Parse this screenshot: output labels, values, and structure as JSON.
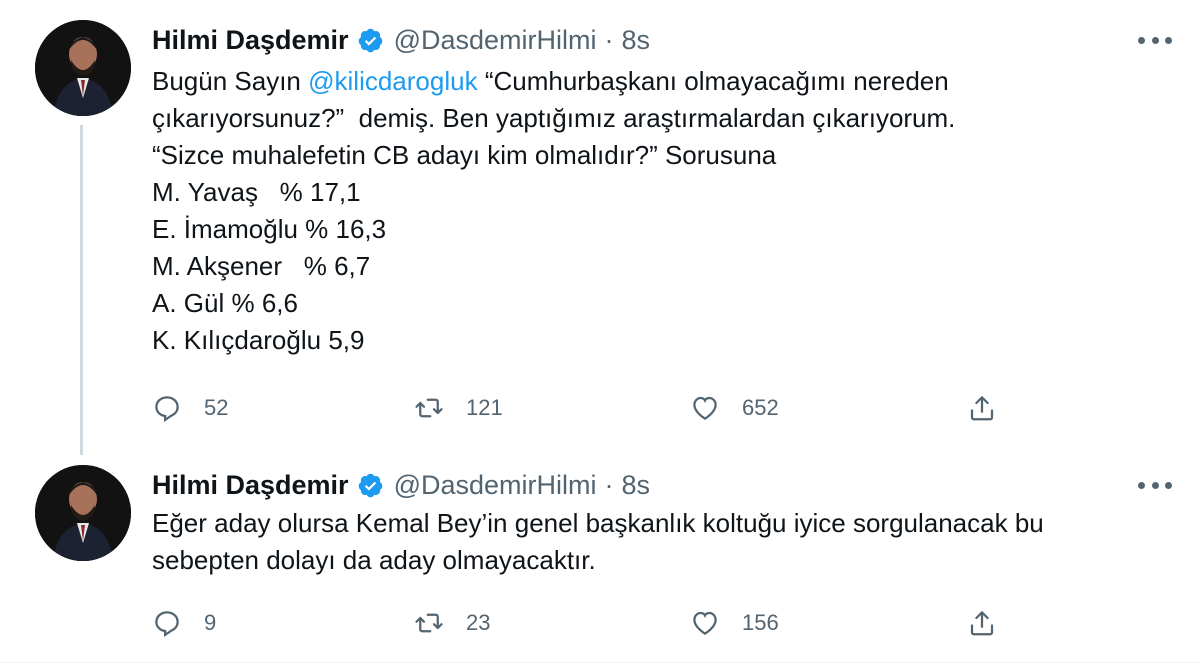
{
  "tweets": [
    {
      "author": {
        "name": "Hilmi Daşdemir",
        "handle": "@DasdemirHilmi",
        "separator": "·",
        "time": "8s"
      },
      "body": {
        "prefix": "Bugün Sayın ",
        "mention": "@kilicdarogluk",
        "line1_rest": " “Cumhurbaşkanı olmayacağımı nereden",
        "lines": [
          "çıkarıyorsunuz?”  demiş. Ben yaptığımız araştırmalardan çıkarıyorum.",
          "“Sizce muhalefetin CB adayı kim olmalıdır?” Sorusuna",
          "M. Yavaş   % 17,1",
          "E. İmamoğlu % 16,3",
          "M. Akşener   % 6,7",
          "A. Gül % 6,6",
          "K. Kılıçdaroğlu 5,9"
        ]
      },
      "actions": {
        "replies": "52",
        "retweets": "121",
        "likes": "652"
      }
    },
    {
      "author": {
        "name": "Hilmi Daşdemir",
        "handle": "@DasdemirHilmi",
        "separator": "·",
        "time": "8s"
      },
      "body": {
        "lines": [
          "Eğer aday olursa Kemal Bey’in genel başkanlık koltuğu iyice sorgulanacak bu",
          "sebepten dolayı da aday olmayacaktır."
        ]
      },
      "actions": {
        "replies": "9",
        "retweets": "23",
        "likes": "156"
      }
    }
  ],
  "icons": {
    "verified": "verified-badge-icon",
    "more": "more-options-icon",
    "reply": "reply-icon",
    "retweet": "retweet-icon",
    "like": "heart-icon",
    "share": "share-icon"
  },
  "colors": {
    "verified": "#1d9bf0",
    "mention": "#1d9bf0",
    "secondary_text": "#536471",
    "thread_line": "#cfd9de"
  }
}
